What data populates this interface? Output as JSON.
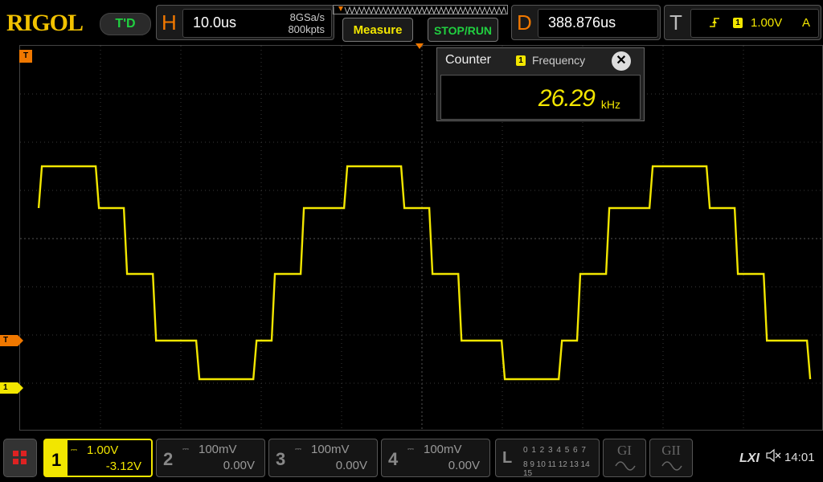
{
  "brand": "RIGOL",
  "status": "T'D",
  "horizontal": {
    "letter": "H",
    "timebase": "10.0us",
    "sample_rate": "8GSa/s",
    "memory_depth": "800kpts"
  },
  "buttons": {
    "measure": "Measure",
    "stop_run": "STOP/RUN"
  },
  "delay": {
    "letter": "D",
    "value": "388.876us"
  },
  "trigger": {
    "letter": "T",
    "channel": "1",
    "level": "1.00V",
    "mode": "A"
  },
  "markers": {
    "trigger_top": "T",
    "trigger_level": "T",
    "ch1_ground": "1"
  },
  "counter": {
    "title": "Counter",
    "channel": "1",
    "source_label": "Frequency",
    "close": "✕",
    "value": "26.29",
    "unit": "kHz"
  },
  "channels": [
    {
      "num": "1",
      "scale": "1.00V",
      "offset": "-3.12V"
    },
    {
      "num": "2",
      "scale": "100mV",
      "offset": "0.00V"
    },
    {
      "num": "3",
      "scale": "100mV",
      "offset": "0.00V"
    },
    {
      "num": "4",
      "scale": "100mV",
      "offset": "0.00V"
    }
  ],
  "coupling_symbol": "⎓",
  "logic": {
    "letter": "L",
    "row1": "0 1 2 3  4 5 6 7",
    "row2": "8 9 10 11 12 13 14 15"
  },
  "generators": {
    "g1": "GI",
    "g2": "GII"
  },
  "system": {
    "lxi": "LXI",
    "time": "14:01"
  },
  "colors": {
    "ch1": "#f2e600",
    "trigger": "#f07800",
    "run": "#20d040",
    "background": "#000000"
  },
  "waveform": {
    "channel": "1",
    "shape": "stepped sine",
    "frequency_khz": 26.29
  }
}
